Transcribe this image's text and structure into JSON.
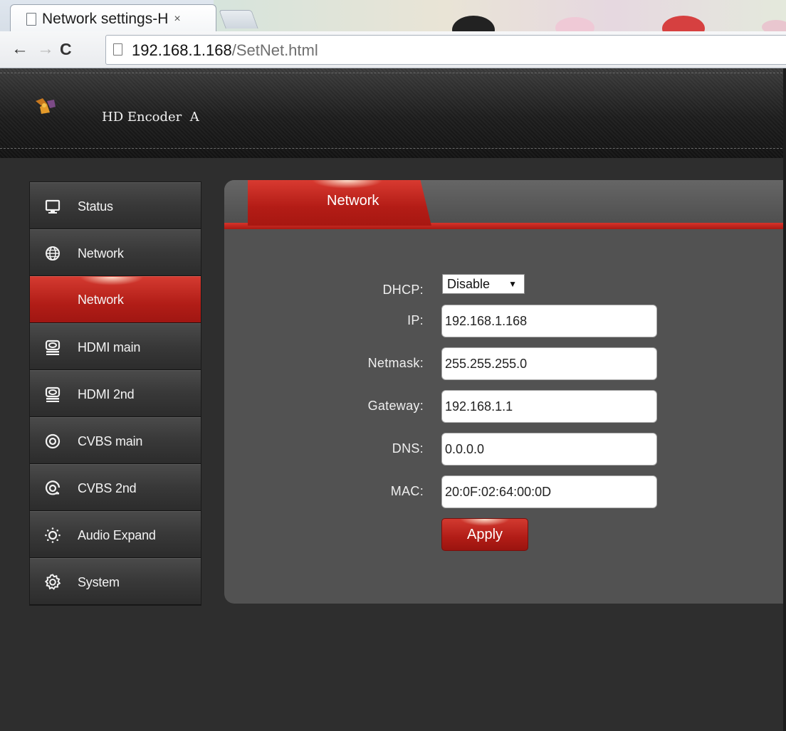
{
  "browser": {
    "tab_title": "Network settings-H",
    "tab_close": "×",
    "url_host": "192.168.1.168",
    "url_path": "/SetNet.html",
    "back": "←",
    "forward": "→",
    "reload": "C"
  },
  "header": {
    "device_name": "HD Encoder  A"
  },
  "sidebar": {
    "items": [
      {
        "label": "Status",
        "icon": "monitor-icon"
      },
      {
        "label": "Network",
        "icon": "globe-icon"
      },
      {
        "label": "Network",
        "icon": "",
        "active": true
      },
      {
        "label": "HDMI main",
        "icon": "hdmi-icon"
      },
      {
        "label": "HDMI 2nd",
        "icon": "hdmi-icon"
      },
      {
        "label": "CVBS main",
        "icon": "target-icon"
      },
      {
        "label": "CVBS 2nd",
        "icon": "target-icon"
      },
      {
        "label": "Audio Expand",
        "icon": "sun-icon"
      },
      {
        "label": "System",
        "icon": "gear-icon"
      }
    ]
  },
  "panel": {
    "tab_label": "Network",
    "form": {
      "dhcp_label": "DHCP:",
      "dhcp_value": "Disable",
      "dhcp_arrow": "▼",
      "ip_label": "IP:",
      "ip_value": "192.168.1.168",
      "netmask_label": "Netmask:",
      "netmask_value": "255.255.255.0",
      "gateway_label": "Gateway:",
      "gateway_value": "192.168.1.1",
      "dns_label": "DNS:",
      "dns_value": "0.0.0.0",
      "mac_label": "MAC:",
      "mac_value": "20:0F:02:64:00:0D"
    },
    "apply_label": "Apply"
  },
  "colors": {
    "accent_red": "#b31c16",
    "panel_bg": "#525252",
    "page_bg": "#2e2e2e"
  }
}
